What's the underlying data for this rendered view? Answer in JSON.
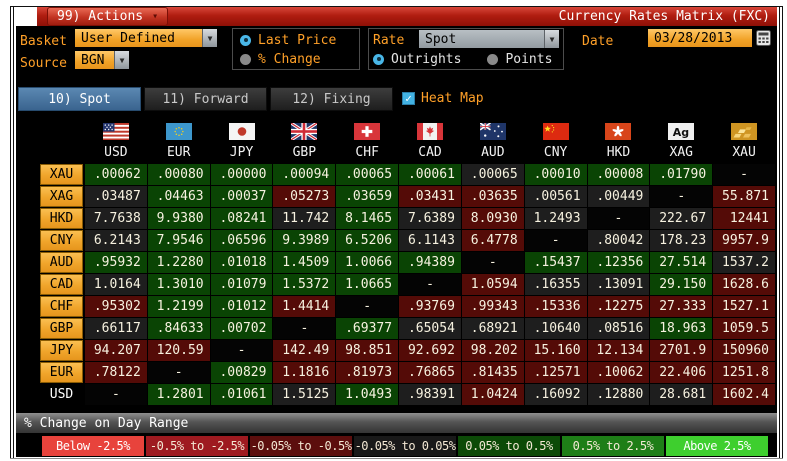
{
  "titlebar": {
    "actions_label": "99) Actions",
    "title": "Currency Rates Matrix (FXC)"
  },
  "controls": {
    "basket_label": "Basket",
    "basket_value": "User Defined",
    "source_label": "Source",
    "source_value": "BGN",
    "price_mode": {
      "options": [
        "Last Price",
        "% Change"
      ],
      "selected": "Last Price"
    },
    "rate_label": "Rate",
    "rate_value": "Spot",
    "rate_mode": {
      "options": [
        "Outrights",
        "Points"
      ],
      "selected": "Outrights"
    },
    "date_label": "Date",
    "date_value": "03/28/2013"
  },
  "tabs": {
    "items": [
      "10) Spot",
      "11) Forward",
      "12) Fixing"
    ],
    "selected": "10) Spot",
    "heatmap_label": "Heat Map",
    "heatmap_checked": true
  },
  "matrix": {
    "columns": [
      {
        "code": "USD",
        "flag": "us-flag-icon"
      },
      {
        "code": "EUR",
        "flag": "eu-flag-icon"
      },
      {
        "code": "JPY",
        "flag": "japan-flag-icon"
      },
      {
        "code": "GBP",
        "flag": "uk-flag-icon"
      },
      {
        "code": "CHF",
        "flag": "switzerland-flag-icon"
      },
      {
        "code": "CAD",
        "flag": "canada-flag-icon"
      },
      {
        "code": "AUD",
        "flag": "australia-flag-icon"
      },
      {
        "code": "CNY",
        "flag": "china-flag-icon"
      },
      {
        "code": "HKD",
        "flag": "hong-kong-flag-icon"
      },
      {
        "code": "XAG",
        "flag": "silver-icon"
      },
      {
        "code": "XAU",
        "flag": "gold-icon"
      }
    ],
    "rows": [
      {
        "label": "XAU",
        "cells": [
          {
            "v": ".00062",
            "h": "g"
          },
          {
            "v": ".00080",
            "h": "g"
          },
          {
            "v": ".00000",
            "h": "g"
          },
          {
            "v": ".00094",
            "h": "g"
          },
          {
            "v": ".00065",
            "h": "g"
          },
          {
            "v": ".00061",
            "h": "g"
          },
          {
            "v": ".00065",
            "h": "d"
          },
          {
            "v": ".00010",
            "h": "g"
          },
          {
            "v": ".00008",
            "h": "g"
          },
          {
            "v": ".01790",
            "h": "g"
          },
          {
            "v": "-",
            "h": "b"
          }
        ]
      },
      {
        "label": "XAG",
        "cells": [
          {
            "v": ".03487",
            "h": "d"
          },
          {
            "v": ".04463",
            "h": "g"
          },
          {
            "v": ".00037",
            "h": "g"
          },
          {
            "v": ".05273",
            "h": "r"
          },
          {
            "v": ".03659",
            "h": "g"
          },
          {
            "v": ".03431",
            "h": "r"
          },
          {
            "v": ".03635",
            "h": "r"
          },
          {
            "v": ".00561",
            "h": "d"
          },
          {
            "v": ".00449",
            "h": "d"
          },
          {
            "v": "-",
            "h": "b"
          },
          {
            "v": "55.871",
            "h": "r"
          }
        ]
      },
      {
        "label": "HKD",
        "cells": [
          {
            "v": "7.7638",
            "h": "d"
          },
          {
            "v": "9.9380",
            "h": "g"
          },
          {
            "v": ".08241",
            "h": "g"
          },
          {
            "v": "11.742",
            "h": "d"
          },
          {
            "v": "8.1465",
            "h": "g"
          },
          {
            "v": "7.6389",
            "h": "d"
          },
          {
            "v": "8.0930",
            "h": "r"
          },
          {
            "v": "1.2493",
            "h": "d"
          },
          {
            "v": "-",
            "h": "b"
          },
          {
            "v": "222.67",
            "h": "d"
          },
          {
            "v": "12441",
            "h": "r"
          }
        ]
      },
      {
        "label": "CNY",
        "cells": [
          {
            "v": "6.2143",
            "h": "d"
          },
          {
            "v": "7.9546",
            "h": "g"
          },
          {
            "v": ".06596",
            "h": "g"
          },
          {
            "v": "9.3989",
            "h": "g"
          },
          {
            "v": "6.5206",
            "h": "g"
          },
          {
            "v": "6.1143",
            "h": "d"
          },
          {
            "v": "6.4778",
            "h": "r"
          },
          {
            "v": "-",
            "h": "b"
          },
          {
            "v": ".80042",
            "h": "d"
          },
          {
            "v": "178.23",
            "h": "d"
          },
          {
            "v": "9957.9",
            "h": "r"
          }
        ]
      },
      {
        "label": "AUD",
        "cells": [
          {
            "v": ".95932",
            "h": "g"
          },
          {
            "v": "1.2280",
            "h": "g"
          },
          {
            "v": ".01018",
            "h": "g"
          },
          {
            "v": "1.4509",
            "h": "g"
          },
          {
            "v": "1.0066",
            "h": "g"
          },
          {
            "v": ".94389",
            "h": "g"
          },
          {
            "v": "-",
            "h": "b"
          },
          {
            "v": ".15437",
            "h": "g"
          },
          {
            "v": ".12356",
            "h": "g"
          },
          {
            "v": "27.514",
            "h": "g"
          },
          {
            "v": "1537.2",
            "h": "d"
          }
        ]
      },
      {
        "label": "CAD",
        "cells": [
          {
            "v": "1.0164",
            "h": "d"
          },
          {
            "v": "1.3010",
            "h": "g"
          },
          {
            "v": ".01079",
            "h": "g"
          },
          {
            "v": "1.5372",
            "h": "g"
          },
          {
            "v": "1.0665",
            "h": "g"
          },
          {
            "v": "-",
            "h": "b"
          },
          {
            "v": "1.0594",
            "h": "r"
          },
          {
            "v": ".16355",
            "h": "d"
          },
          {
            "v": ".13091",
            "h": "d"
          },
          {
            "v": "29.150",
            "h": "g"
          },
          {
            "v": "1628.6",
            "h": "r"
          }
        ]
      },
      {
        "label": "CHF",
        "cells": [
          {
            "v": ".95302",
            "h": "r"
          },
          {
            "v": "1.2199",
            "h": "g"
          },
          {
            "v": ".01012",
            "h": "g"
          },
          {
            "v": "1.4414",
            "h": "r"
          },
          {
            "v": "-",
            "h": "b"
          },
          {
            "v": ".93769",
            "h": "r"
          },
          {
            "v": ".99343",
            "h": "r"
          },
          {
            "v": ".15336",
            "h": "r"
          },
          {
            "v": ".12275",
            "h": "r"
          },
          {
            "v": "27.333",
            "h": "r"
          },
          {
            "v": "1527.1",
            "h": "r"
          }
        ]
      },
      {
        "label": "GBP",
        "cells": [
          {
            "v": ".66117",
            "h": "d"
          },
          {
            "v": ".84633",
            "h": "g"
          },
          {
            "v": ".00702",
            "h": "g"
          },
          {
            "v": "-",
            "h": "b"
          },
          {
            "v": ".69377",
            "h": "g"
          },
          {
            "v": ".65054",
            "h": "d"
          },
          {
            "v": ".68921",
            "h": "d"
          },
          {
            "v": ".10640",
            "h": "d"
          },
          {
            "v": ".08516",
            "h": "d"
          },
          {
            "v": "18.963",
            "h": "g"
          },
          {
            "v": "1059.5",
            "h": "r"
          }
        ]
      },
      {
        "label": "JPY",
        "cells": [
          {
            "v": "94.207",
            "h": "r"
          },
          {
            "v": "120.59",
            "h": "r"
          },
          {
            "v": "-",
            "h": "b"
          },
          {
            "v": "142.49",
            "h": "r"
          },
          {
            "v": "98.851",
            "h": "r"
          },
          {
            "v": "92.692",
            "h": "r"
          },
          {
            "v": "98.202",
            "h": "r"
          },
          {
            "v": "15.160",
            "h": "r"
          },
          {
            "v": "12.134",
            "h": "r"
          },
          {
            "v": "2701.9",
            "h": "r"
          },
          {
            "v": "150960",
            "h": "r"
          }
        ]
      },
      {
        "label": "EUR",
        "cells": [
          {
            "v": ".78122",
            "h": "r"
          },
          {
            "v": "-",
            "h": "b"
          },
          {
            "v": ".00829",
            "h": "g"
          },
          {
            "v": "1.1816",
            "h": "r"
          },
          {
            "v": ".81973",
            "h": "r"
          },
          {
            "v": ".76865",
            "h": "r"
          },
          {
            "v": ".81435",
            "h": "r"
          },
          {
            "v": ".12571",
            "h": "r"
          },
          {
            "v": ".10062",
            "h": "r"
          },
          {
            "v": "22.406",
            "h": "r"
          },
          {
            "v": "1251.8",
            "h": "r"
          }
        ]
      },
      {
        "label": "USD",
        "plain": true,
        "cells": [
          {
            "v": "-",
            "h": "b"
          },
          {
            "v": "1.2801",
            "h": "g"
          },
          {
            "v": ".01061",
            "h": "g"
          },
          {
            "v": "1.5125",
            "h": "d"
          },
          {
            "v": "1.0493",
            "h": "g"
          },
          {
            "v": ".98391",
            "h": "d"
          },
          {
            "v": "1.0424",
            "h": "r"
          },
          {
            "v": ".16092",
            "h": "d"
          },
          {
            "v": ".12880",
            "h": "d"
          },
          {
            "v": "28.681",
            "h": "d"
          },
          {
            "v": "1602.4",
            "h": "r"
          }
        ]
      }
    ]
  },
  "heat_colors": {
    "g": "#0a4404",
    "d": "#1e1e1e",
    "r": "#540b07",
    "b": "#040404"
  },
  "legend": {
    "title": "% Change on Day Range",
    "items": [
      {
        "label": "Below -2.5%",
        "color": "#e8433c",
        "text_color": "#ffffff"
      },
      {
        "label": "-0.5% to -2.5%",
        "color": "#9e1a20",
        "text_color": "#f3e8d4"
      },
      {
        "label": "-0.05% to -0.5%",
        "color": "#5c0e0d",
        "text_color": "#f3e8d4"
      },
      {
        "label": "-0.05% to 0.05%",
        "color": "#191919",
        "text_color": "#f3e8d4"
      },
      {
        "label": "0.05% to 0.5%",
        "color": "#0c4a07",
        "text_color": "#f3e8d4"
      },
      {
        "label": "0.5% to 2.5%",
        "color": "#1e7e17",
        "text_color": "#f3e8d4"
      },
      {
        "label": "Above 2.5%",
        "color": "#3ecf2e",
        "text_color": "#ffffff"
      }
    ]
  }
}
